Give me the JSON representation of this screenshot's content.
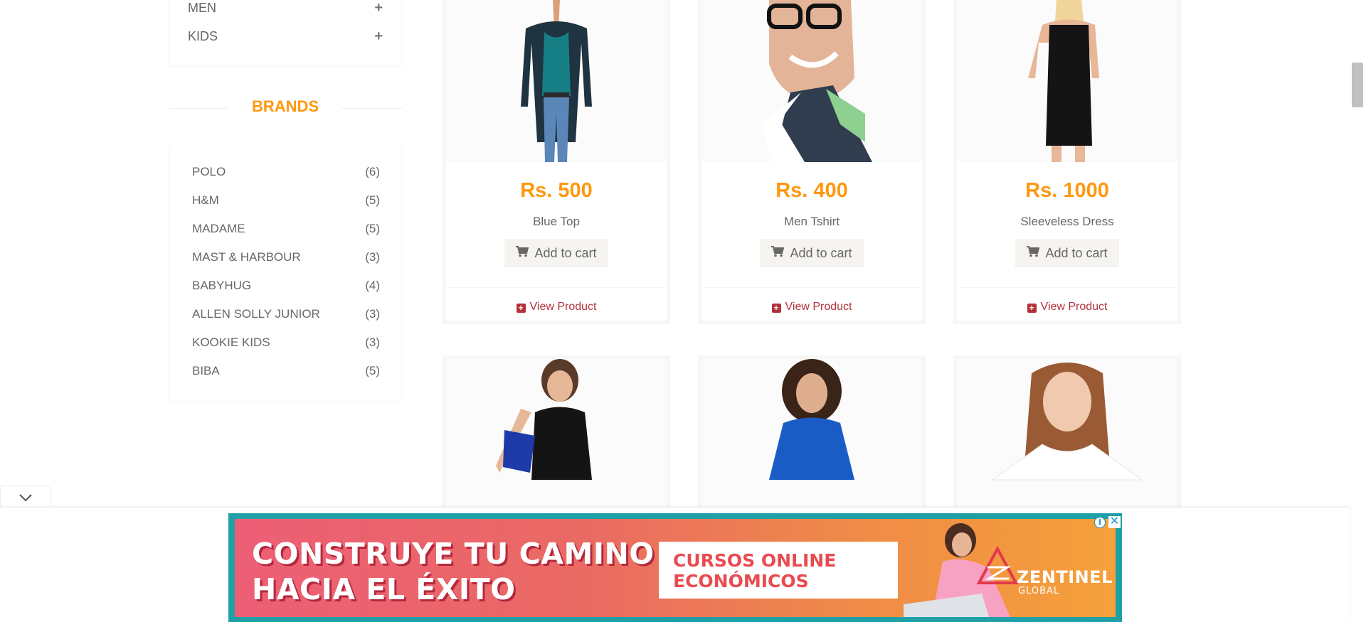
{
  "sidebar": {
    "categories": [
      {
        "label": "MEN"
      },
      {
        "label": "KIDS"
      }
    ],
    "brands_title": "BRANDS",
    "brands": [
      {
        "name": "POLO",
        "count": "(6)"
      },
      {
        "name": "H&M",
        "count": "(5)"
      },
      {
        "name": "MADAME",
        "count": "(5)"
      },
      {
        "name": "MAST & HARBOUR",
        "count": "(3)"
      },
      {
        "name": "BABYHUG",
        "count": "(4)"
      },
      {
        "name": "ALLEN SOLLY JUNIOR",
        "count": "(3)"
      },
      {
        "name": "KOOKIE KIDS",
        "count": "(3)"
      },
      {
        "name": "BIBA",
        "count": "(5)"
      }
    ]
  },
  "products": [
    {
      "price": "Rs. 500",
      "name": "Blue Top",
      "add_label": "Add to cart",
      "view_label": "View Product"
    },
    {
      "price": "Rs. 400",
      "name": "Men Tshirt",
      "add_label": "Add to cart",
      "view_label": "View Product"
    },
    {
      "price": "Rs. 1000",
      "name": "Sleeveless Dress",
      "add_label": "Add to cart",
      "view_label": "View Product"
    }
  ],
  "ad": {
    "headline_line1": "CONSTRUYE TU CAMINO",
    "headline_line2": "HACIA EL ÉXITO",
    "box_line1": "CURSOS ONLINE",
    "box_line2": "ECONÓMICOS",
    "brand": "ZENTINEL",
    "brand_sub": "GLOBAL",
    "info_glyph": "i",
    "close_glyph": "✕"
  },
  "colors": {
    "accent": "#fe980f",
    "view_link": "#b3313a",
    "ad_border": "#1fa0a6"
  }
}
